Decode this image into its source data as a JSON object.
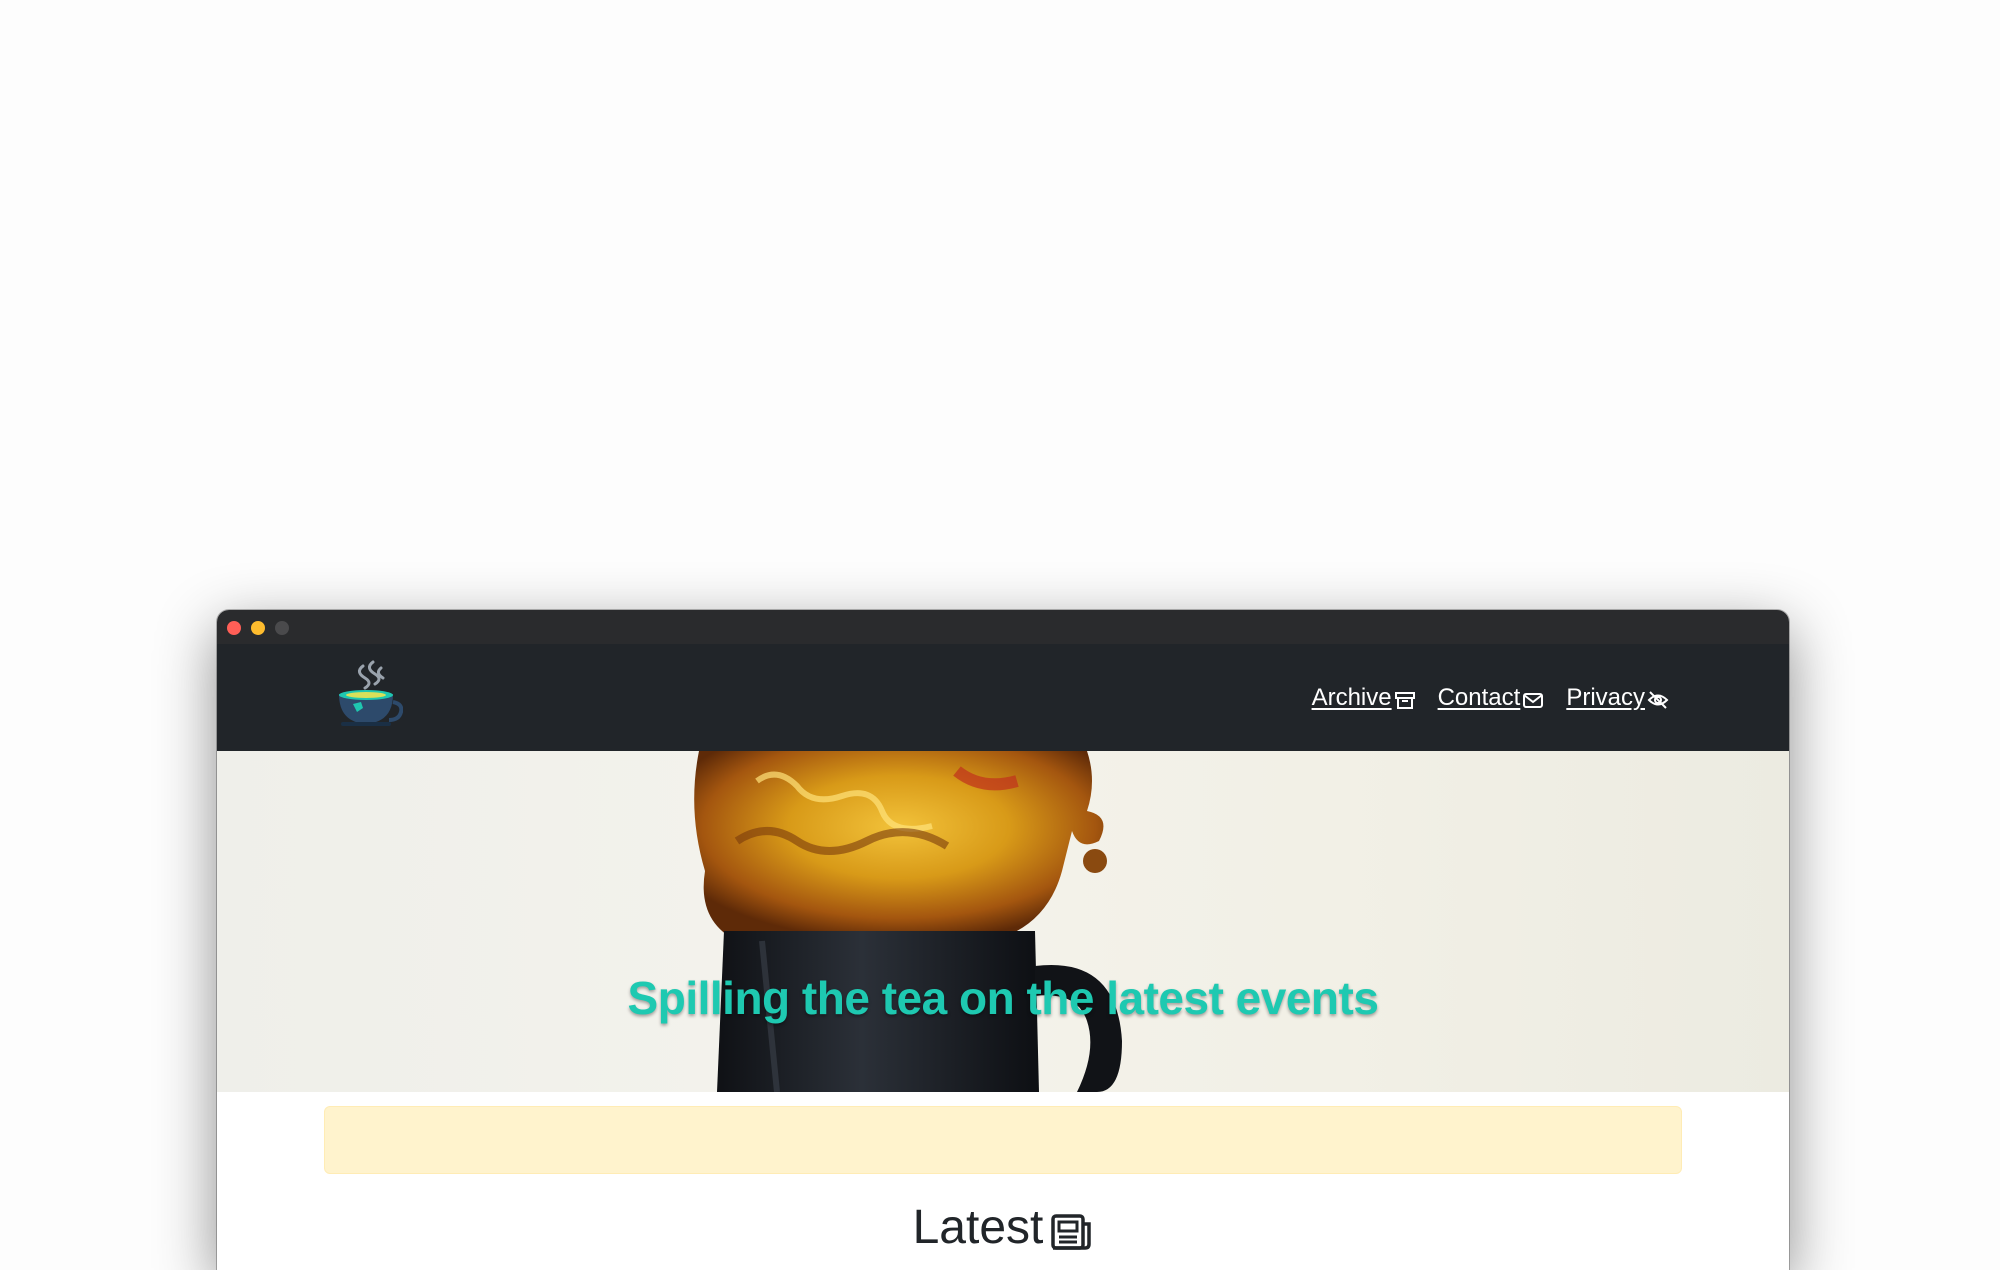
{
  "navbar": {
    "links": [
      {
        "label": "Archive",
        "icon": "archive-icon"
      },
      {
        "label": "Contact",
        "icon": "envelope-icon"
      },
      {
        "label": "Privacy",
        "icon": "eye-slash-icon"
      }
    ]
  },
  "hero": {
    "title": "Spilling the tea on the latest events"
  },
  "main": {
    "heading": "Latest",
    "heading_icon": "newspaper-icon"
  },
  "colors": {
    "navbar_bg": "#212529",
    "hero_title": "#1ec9b1",
    "alert_bg": "#fff3cd"
  }
}
